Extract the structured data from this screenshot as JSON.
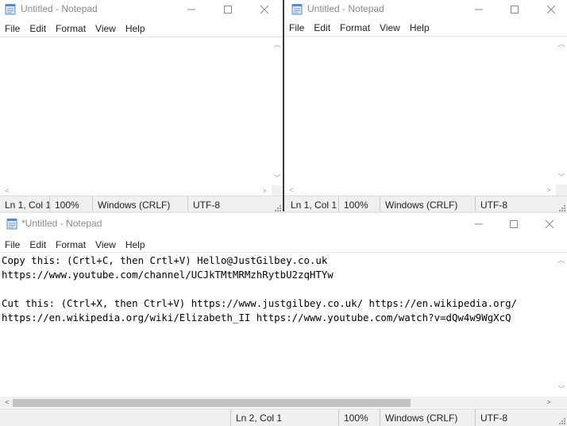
{
  "windows": [
    {
      "title": "Untitled - Notepad",
      "menu": [
        "File",
        "Edit",
        "Format",
        "View",
        "Help"
      ],
      "content": "",
      "status": {
        "position": "Ln 1, Col 1",
        "zoom": "100%",
        "line_ending": "Windows (CRLF)",
        "encoding": "UTF-8"
      }
    },
    {
      "title": "Untitled - Notepad",
      "menu": [
        "File",
        "Edit",
        "Format",
        "View",
        "Help"
      ],
      "content": "",
      "status": {
        "position": "Ln 1, Col 1",
        "zoom": "100%",
        "line_ending": "Windows (CRLF)",
        "encoding": "UTF-8"
      }
    },
    {
      "title": "*Untitled - Notepad",
      "menu": [
        "File",
        "Edit",
        "Format",
        "View",
        "Help"
      ],
      "content": "Copy this: (Crtl+C, then Crtl+V) Hello@JustGilbey.co.uk\nhttps://www.youtube.com/channel/UCJkTMtMRMzhRytbU2zqHTYw\n\nCut this: (Ctrl+X, then Ctrl+V) https://www.justgilbey.co.uk/ https://en.wikipedia.org/\nhttps://en.wikipedia.org/wiki/Elizabeth_II https://www.youtube.com/watch?v=dQw4w9WgXcQ",
      "horizontal_scroll_fraction": 0.75,
      "status": {
        "position": "Ln 2, Col 1",
        "zoom": "100%",
        "line_ending": "Windows (CRLF)",
        "encoding": "UTF-8"
      }
    }
  ],
  "icons": {
    "app": "notepad-icon",
    "minimize": "minimize-icon",
    "maximize": "maximize-icon",
    "close": "close-icon"
  }
}
